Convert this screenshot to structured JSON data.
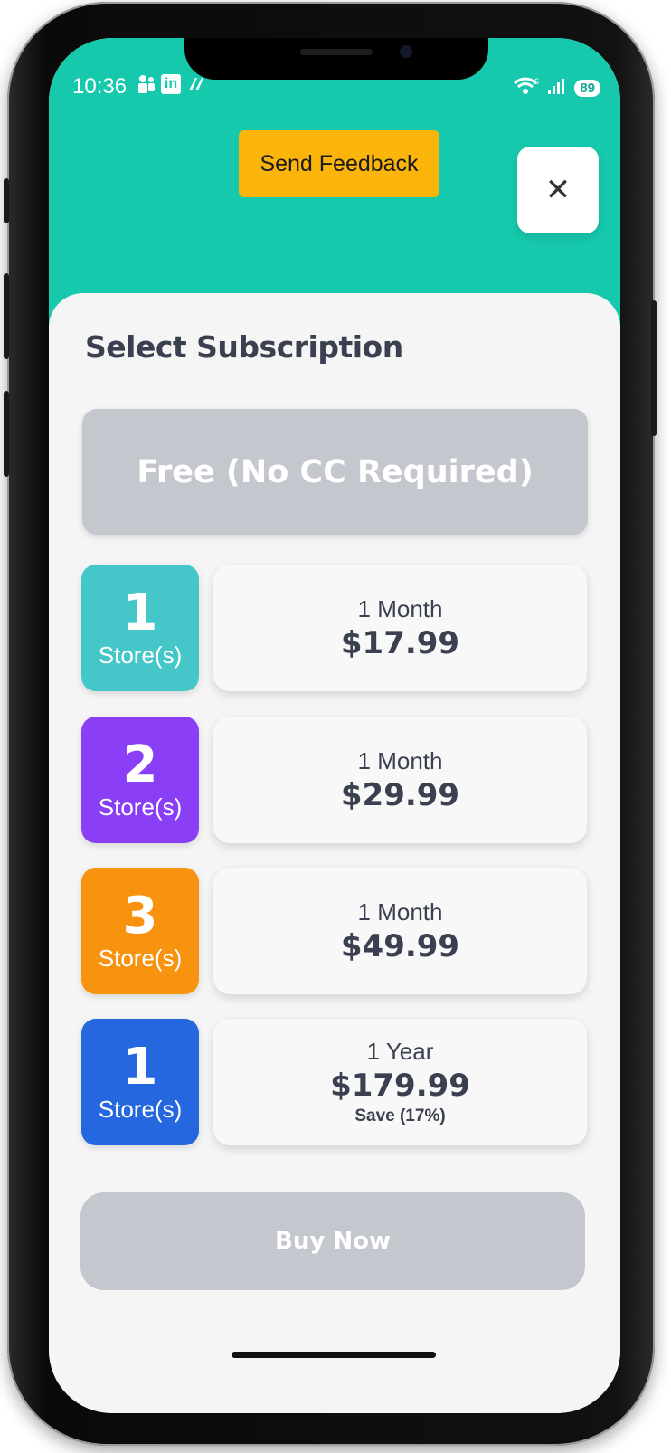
{
  "status_bar": {
    "time": "10:36",
    "left_icons": [
      "teams-icon",
      "linkedin-icon",
      "app-icon"
    ],
    "linkedin_text": "in",
    "battery": "89"
  },
  "header": {
    "feedback_label": "Send Feedback",
    "close_symbol": "✕",
    "accent_color": "#16c9ad",
    "feedback_color": "#fbb40a"
  },
  "sheet": {
    "title": "Select Subscription",
    "free_option": "Free (No CC Required)",
    "plans": [
      {
        "count": "1",
        "label": "Store(s)",
        "period": "1 Month",
        "price": "$17.99",
        "save": "",
        "color": "#45c6c8"
      },
      {
        "count": "2",
        "label": "Store(s)",
        "period": "1 Month",
        "price": "$29.99",
        "save": "",
        "color": "#8a3ef5"
      },
      {
        "count": "3",
        "label": "Store(s)",
        "period": "1 Month",
        "price": "$49.99",
        "save": "",
        "color": "#f7930e"
      },
      {
        "count": "1",
        "label": "Store(s)",
        "period": "1 Year",
        "price": "$179.99",
        "save": "Save (17%)",
        "color": "#2467de"
      }
    ],
    "buy_label": "Buy Now"
  }
}
